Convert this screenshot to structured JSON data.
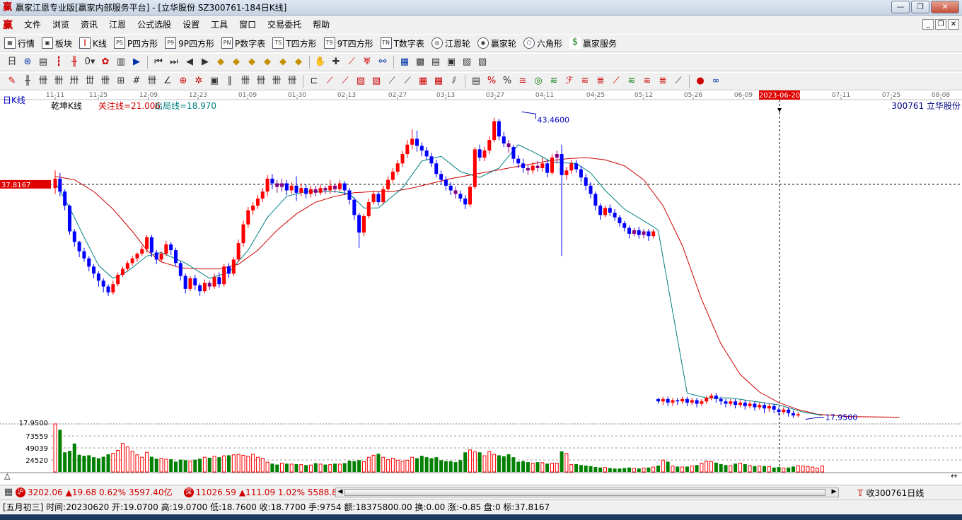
{
  "window": {
    "title": "赢家江恩专业版[赢家内部服务平台] - [立华股份  SZ300761-184日K线]",
    "logo_glyph": "赢"
  },
  "menu": {
    "items": [
      "文件",
      "浏览",
      "资讯",
      "江恩",
      "公式选股",
      "设置",
      "工具",
      "窗口",
      "交易委托",
      "帮助"
    ]
  },
  "toolbar1": {
    "items": [
      {
        "label": "行情",
        "icon": "grid-icon"
      },
      {
        "label": "板块",
        "icon": "blocks-icon"
      },
      {
        "label": "K线",
        "icon": "kline-icon"
      },
      {
        "label": "P四方形",
        "icon": "p-square-icon",
        "tag": "PS"
      },
      {
        "label": "9P四方形",
        "icon": "9p-square-icon",
        "tag": "P9"
      },
      {
        "label": "P数字表",
        "icon": "p-number-table-icon",
        "tag": "PN"
      },
      {
        "label": "T四方形",
        "icon": "t-square-icon",
        "tag": "TS"
      },
      {
        "label": "9T四方形",
        "icon": "9t-square-icon",
        "tag": "T9"
      },
      {
        "label": "T数字表",
        "icon": "t-number-table-icon",
        "tag": "TN"
      },
      {
        "label": "江恩轮",
        "icon": "gann-wheel-icon"
      },
      {
        "label": "赢家轮",
        "icon": "winner-wheel-icon"
      },
      {
        "label": "六角形",
        "icon": "hexagon-icon"
      },
      {
        "label": "赢家服务",
        "icon": "dollar-icon"
      }
    ]
  },
  "chart": {
    "period_label": "日K线",
    "indicator_name": "乾坤K线",
    "focus_line": "关注线=21.006",
    "exit_line": "出局线=18.970",
    "stock_label": "300761  立华股份",
    "cursor_price": "37.8167",
    "cursor_date": "2023-06-20",
    "high_label": "43.4600",
    "low_label": "17.9500",
    "vol_axis": [
      "17.9500",
      "73559",
      "49039",
      "24520"
    ],
    "dates": [
      "11-11",
      "11-25",
      "12-09",
      "12-23",
      "01-09",
      "01-30",
      "02-13",
      "02-27",
      "03-13",
      "03-27",
      "04-11",
      "04-25",
      "05-12",
      "05-26",
      "06-09",
      "2023-06-20",
      "07-11",
      "07-25",
      "08-08"
    ],
    "colors": {
      "up": "#ff0000",
      "down": "#0000ff",
      "neutral": "#800080",
      "vol_up": "#ff0000",
      "vol_down": "#008000",
      "ma_long": "#cc0000",
      "ma_short": "#008080"
    }
  },
  "chart_data": {
    "type": "candlestick",
    "price_range": [
      17.5,
      44.5
    ],
    "candles": [
      [
        37.5,
        38.3,
        39.0,
        37.0
      ],
      [
        38.3,
        37.2,
        38.8,
        36.8
      ],
      [
        37.2,
        36.0,
        37.4,
        35.6
      ],
      [
        36.0,
        33.8,
        36.1,
        33.5
      ],
      [
        33.8,
        32.9,
        34.0,
        32.5
      ],
      [
        32.9,
        32.1,
        33.0,
        31.6
      ],
      [
        32.1,
        31.5,
        32.4,
        31.2
      ],
      [
        31.5,
        30.8,
        31.7,
        30.4
      ],
      [
        30.8,
        30.2,
        31.0,
        29.8
      ],
      [
        30.2,
        29.6,
        30.4,
        29.1
      ],
      [
        29.6,
        29.1,
        29.8,
        28.6
      ],
      [
        29.1,
        28.6,
        29.3,
        28.3
      ],
      [
        28.6,
        29.3,
        29.6,
        28.4
      ],
      [
        29.3,
        30.1,
        30.3,
        29.1
      ],
      [
        30.1,
        30.6,
        30.8,
        29.9
      ],
      [
        30.6,
        31.1,
        31.3,
        30.4
      ],
      [
        31.1,
        31.5,
        31.7,
        30.9
      ],
      [
        31.5,
        31.9,
        32.0,
        31.2
      ],
      [
        31.9,
        32.3,
        32.6,
        31.7
      ],
      [
        32.3,
        33.3,
        33.5,
        32.0
      ],
      [
        33.3,
        32.0,
        33.5,
        31.6
      ],
      [
        32.0,
        31.4,
        32.2,
        31.0
      ],
      [
        31.4,
        31.9,
        32.1,
        31.2
      ],
      [
        31.9,
        32.7,
        33.0,
        31.7
      ],
      [
        32.7,
        32.2,
        32.9,
        31.8
      ],
      [
        32.2,
        31.1,
        32.4,
        30.8
      ],
      [
        31.1,
        30.0,
        31.3,
        29.6
      ],
      [
        30.0,
        28.9,
        30.2,
        28.5
      ],
      [
        28.9,
        29.8,
        30.0,
        28.7
      ],
      [
        29.8,
        29.2,
        30.1,
        28.8
      ],
      [
        29.2,
        28.7,
        29.4,
        28.3
      ],
      [
        28.7,
        29.4,
        29.7,
        28.5
      ],
      [
        29.4,
        29.1,
        29.6,
        28.8
      ],
      [
        29.1,
        29.9,
        30.2,
        28.9
      ],
      [
        29.9,
        29.3,
        30.3,
        29.0
      ],
      [
        29.3,
        30.8,
        31.0,
        29.1
      ],
      [
        30.8,
        30.2,
        31.1,
        29.8
      ],
      [
        30.2,
        31.4,
        31.6,
        30.0
      ],
      [
        31.4,
        32.8,
        33.1,
        31.2
      ],
      [
        32.8,
        34.4,
        34.7,
        32.5
      ],
      [
        34.4,
        35.6,
        35.9,
        34.1
      ],
      [
        35.6,
        36.0,
        36.3,
        35.2
      ],
      [
        36.0,
        36.6,
        36.9,
        35.7
      ],
      [
        36.6,
        37.2,
        37.5,
        36.3
      ],
      [
        37.2,
        38.3,
        38.6,
        36.8
      ],
      [
        38.3,
        37.9,
        38.7,
        37.4
      ],
      [
        37.9,
        37.6,
        38.2,
        37.1
      ],
      [
        37.6,
        37.9,
        38.3,
        37.2
      ],
      [
        37.9,
        37.3,
        38.2,
        36.9
      ],
      [
        37.3,
        37.7,
        38.0,
        37.0
      ],
      [
        37.7,
        37.1,
        38.5,
        36.4
      ],
      [
        37.1,
        37.5,
        37.9,
        36.8
      ],
      [
        37.5,
        37.0,
        37.8,
        36.6
      ],
      [
        37.0,
        37.4,
        37.7,
        36.7
      ],
      [
        37.4,
        37.1,
        37.7,
        36.8
      ],
      [
        37.1,
        37.5,
        37.8,
        36.9
      ],
      [
        37.5,
        37.3,
        37.7,
        37.0
      ],
      [
        37.3,
        37.7,
        38.2,
        37.0
      ],
      [
        37.7,
        37.4,
        37.9,
        37.1
      ],
      [
        37.4,
        37.9,
        38.2,
        37.2
      ],
      [
        37.9,
        37.3,
        38.1,
        36.9
      ],
      [
        37.3,
        36.5,
        37.5,
        36.1
      ],
      [
        36.5,
        35.2,
        36.7,
        34.8
      ],
      [
        35.2,
        33.7,
        35.4,
        32.4
      ],
      [
        33.7,
        35.1,
        35.3,
        33.4
      ],
      [
        35.1,
        36.3,
        36.6,
        34.9
      ],
      [
        36.3,
        37.0,
        37.3,
        36.1
      ],
      [
        37.0,
        36.3,
        37.2,
        36.0
      ],
      [
        36.3,
        37.4,
        37.7,
        36.1
      ],
      [
        37.4,
        38.2,
        38.5,
        37.2
      ],
      [
        38.2,
        38.9,
        39.2,
        37.9
      ],
      [
        38.9,
        39.6,
        39.9,
        38.6
      ],
      [
        39.6,
        40.4,
        40.7,
        39.3
      ],
      [
        40.4,
        41.2,
        41.6,
        40.1
      ],
      [
        41.2,
        41.7,
        42.5,
        40.8
      ],
      [
        41.7,
        41.1,
        42.4,
        40.6
      ],
      [
        41.1,
        40.7,
        41.4,
        40.2
      ],
      [
        40.7,
        40.2,
        41.0,
        39.9
      ],
      [
        40.2,
        39.6,
        40.5,
        39.3
      ],
      [
        39.6,
        38.7,
        39.9,
        38.4
      ],
      [
        38.7,
        38.2,
        39.0,
        37.8
      ],
      [
        38.2,
        37.7,
        38.5,
        37.3
      ],
      [
        37.7,
        37.3,
        38.0,
        36.9
      ],
      [
        37.3,
        37.0,
        37.6,
        36.6
      ],
      [
        37.0,
        36.6,
        37.3,
        36.3
      ],
      [
        36.6,
        36.1,
        36.9,
        35.7
      ],
      [
        36.1,
        37.6,
        37.8,
        35.9
      ],
      [
        37.6,
        40.8,
        41.0,
        37.4
      ],
      [
        40.8,
        40.1,
        41.2,
        39.8
      ],
      [
        40.1,
        40.7,
        41.0,
        39.8
      ],
      [
        40.7,
        41.6,
        41.9,
        40.4
      ],
      [
        41.6,
        43.2,
        43.5,
        41.4
      ],
      [
        43.2,
        41.9,
        43.4,
        41.6
      ],
      [
        41.9,
        41.3,
        42.3,
        41.0
      ],
      [
        41.3,
        41.0,
        41.6,
        40.5
      ],
      [
        41.0,
        40.0,
        41.2,
        39.6
      ],
      [
        40.0,
        39.6,
        40.3,
        39.2
      ],
      [
        39.6,
        39.2,
        40.0,
        38.8
      ],
      [
        39.2,
        39.0,
        39.5,
        38.6
      ],
      [
        39.0,
        39.4,
        39.7,
        38.7
      ],
      [
        39.4,
        39.2,
        39.8,
        38.9
      ],
      [
        39.2,
        39.6,
        40.1,
        38.9
      ],
      [
        39.6,
        38.8,
        39.9,
        38.4
      ],
      [
        38.8,
        40.1,
        40.4,
        38.6
      ],
      [
        40.1,
        40.4,
        40.7,
        39.6
      ],
      [
        40.4,
        38.6,
        41.2,
        31.7
      ],
      [
        38.6,
        39.0,
        39.3,
        38.2
      ],
      [
        39.0,
        39.6,
        39.9,
        38.7
      ],
      [
        39.6,
        39.1,
        39.9,
        38.8
      ],
      [
        39.1,
        38.4,
        39.4,
        38.0
      ],
      [
        38.4,
        37.7,
        38.7,
        37.3
      ],
      [
        37.7,
        37.0,
        38.0,
        36.6
      ],
      [
        37.0,
        36.0,
        37.2,
        35.6
      ],
      [
        36.0,
        35.2,
        36.2,
        34.8
      ],
      [
        35.2,
        35.8,
        36.0,
        35.0
      ],
      [
        35.8,
        35.4,
        36.1,
        35.1
      ],
      [
        35.4,
        35.0,
        35.7,
        34.7
      ],
      [
        35.0,
        34.5,
        35.2,
        34.2
      ],
      [
        34.5,
        34.1,
        34.7,
        33.8
      ],
      [
        34.1,
        33.6,
        34.3,
        33.2
      ],
      [
        33.6,
        33.9,
        34.1,
        33.4
      ],
      [
        33.9,
        33.5,
        34.2,
        33.2
      ],
      [
        33.5,
        33.8,
        34.0,
        33.2
      ],
      [
        33.8,
        33.4,
        34.0,
        33.0
      ],
      [
        33.4,
        33.8,
        34.0,
        33.2
      ],
      [
        19.5,
        19.3,
        19.6,
        19.1
      ],
      [
        19.3,
        19.5,
        19.7,
        19.0
      ],
      [
        19.5,
        19.2,
        19.7,
        18.9
      ],
      [
        19.2,
        19.4,
        19.6,
        18.9
      ],
      [
        19.4,
        19.3,
        19.6,
        19.0
      ],
      [
        19.3,
        19.5,
        19.7,
        19.1
      ],
      [
        19.5,
        19.2,
        19.7,
        18.9
      ],
      [
        19.2,
        19.4,
        19.6,
        19.0
      ],
      [
        19.4,
        19.1,
        19.6,
        18.8
      ],
      [
        19.1,
        19.3,
        19.5,
        18.9
      ],
      [
        19.3,
        19.6,
        19.8,
        19.1
      ],
      [
        19.6,
        19.8,
        20.0,
        19.4
      ],
      [
        19.8,
        19.5,
        20.0,
        19.2
      ],
      [
        19.5,
        19.3,
        19.7,
        19.0
      ],
      [
        19.3,
        19.1,
        19.5,
        18.8
      ],
      [
        19.1,
        19.3,
        19.5,
        18.9
      ],
      [
        19.3,
        19.0,
        19.5,
        18.7
      ],
      [
        19.0,
        19.2,
        19.4,
        18.8
      ],
      [
        19.2,
        18.9,
        19.4,
        18.6
      ],
      [
        18.9,
        19.1,
        19.3,
        18.7
      ],
      [
        19.1,
        18.8,
        19.3,
        18.5
      ],
      [
        18.8,
        19.0,
        19.2,
        18.6
      ],
      [
        19.0,
        18.7,
        19.2,
        18.3
      ],
      [
        18.7,
        18.9,
        19.1,
        18.4
      ],
      [
        18.9,
        18.6,
        19.1,
        18.3
      ],
      [
        18.6,
        18.4,
        18.8,
        18.1
      ],
      [
        18.4,
        18.6,
        18.8,
        18.2
      ],
      [
        18.6,
        18.3,
        18.8,
        18.0
      ],
      [
        18.3,
        18.1,
        18.5,
        17.9
      ],
      [
        18.1,
        18.2,
        18.4,
        17.95
      ]
    ],
    "ma_short": [
      [
        0,
        38.0
      ],
      [
        3,
        35.8
      ],
      [
        6,
        33.3
      ],
      [
        9,
        30.9
      ],
      [
        12,
        29.8
      ],
      [
        15,
        30.4
      ],
      [
        19,
        31.7
      ],
      [
        22,
        32.0
      ],
      [
        27,
        31.1
      ],
      [
        32,
        29.8
      ],
      [
        36,
        30.3
      ],
      [
        40,
        32.2
      ],
      [
        44,
        35.0
      ],
      [
        48,
        36.8
      ],
      [
        52,
        37.2
      ],
      [
        58,
        37.2
      ],
      [
        61,
        37.0
      ],
      [
        64,
        35.8
      ],
      [
        67,
        35.8
      ],
      [
        72,
        37.5
      ],
      [
        76,
        39.8
      ],
      [
        80,
        40.2
      ],
      [
        84,
        38.9
      ],
      [
        88,
        38.4
      ],
      [
        92,
        39.2
      ],
      [
        96,
        41.2
      ],
      [
        99,
        40.6
      ],
      [
        103,
        39.7
      ],
      [
        108,
        39.6
      ],
      [
        111,
        38.8
      ],
      [
        114,
        37.3
      ],
      [
        118,
        35.7
      ],
      [
        124,
        34.2
      ],
      [
        125,
        33.9
      ],
      [
        131,
        20.0
      ],
      [
        135,
        19.6
      ],
      [
        140,
        19.6
      ],
      [
        145,
        19.3
      ],
      [
        150,
        19.0
      ],
      [
        155,
        18.4
      ],
      [
        159,
        18.1
      ]
    ],
    "ma_long": [
      [
        0,
        38.5
      ],
      [
        4,
        38.2
      ],
      [
        8,
        37.2
      ],
      [
        12,
        35.7
      ],
      [
        16,
        33.8
      ],
      [
        19,
        32.2
      ],
      [
        22,
        31.2
      ],
      [
        26,
        30.7
      ],
      [
        30,
        30.6
      ],
      [
        34,
        30.6
      ],
      [
        38,
        31.0
      ],
      [
        42,
        32.2
      ],
      [
        46,
        33.9
      ],
      [
        50,
        35.3
      ],
      [
        54,
        36.3
      ],
      [
        58,
        36.8
      ],
      [
        62,
        37.1
      ],
      [
        66,
        37.2
      ],
      [
        70,
        37.2
      ],
      [
        74,
        37.5
      ],
      [
        78,
        37.9
      ],
      [
        82,
        38.3
      ],
      [
        86,
        38.6
      ],
      [
        90,
        38.9
      ],
      [
        94,
        39.2
      ],
      [
        98,
        39.5
      ],
      [
        102,
        39.8
      ],
      [
        106,
        40.0
      ],
      [
        110,
        40.1
      ],
      [
        114,
        39.9
      ],
      [
        118,
        39.4
      ],
      [
        122,
        38.2
      ],
      [
        126,
        36.0
      ],
      [
        130,
        32.6
      ],
      [
        134,
        28.0
      ],
      [
        138,
        24.2
      ],
      [
        142,
        21.6
      ],
      [
        146,
        20.1
      ],
      [
        150,
        19.2
      ],
      [
        154,
        18.6
      ],
      [
        158,
        18.2
      ],
      [
        165,
        18.0
      ],
      [
        175,
        17.95
      ]
    ],
    "volumes": [
      98000,
      86000,
      40000,
      43000,
      58000,
      35000,
      33000,
      34000,
      30000,
      28000,
      31000,
      36000,
      38000,
      44000,
      58000,
      51000,
      42000,
      35000,
      30000,
      40000,
      31000,
      27000,
      28000,
      26000,
      26000,
      21000,
      25000,
      24000,
      22000,
      25000,
      27000,
      30000,
      29000,
      32000,
      30000,
      33000,
      34000,
      35000,
      36000,
      34000,
      32000,
      36000,
      30000,
      28000,
      20000,
      17000,
      15000,
      18000,
      17000,
      16000,
      16000,
      15000,
      14000,
      14000,
      18000,
      16000,
      15000,
      15000,
      17000,
      16000,
      18000,
      23000,
      22000,
      24000,
      21000,
      30000,
      34000,
      37000,
      30000,
      25000,
      28000,
      24000,
      22000,
      24000,
      30000,
      28000,
      33000,
      30000,
      28000,
      30000,
      24000,
      22000,
      22000,
      20000,
      24000,
      40000,
      45000,
      41000,
      40000,
      33000,
      42000,
      36000,
      34000,
      32000,
      36000,
      30000,
      21000,
      22000,
      20000,
      18000,
      20000,
      19000,
      17000,
      18000,
      18000,
      42000,
      38000,
      15000,
      16000,
      14000,
      13000,
      12000,
      10000,
      9000,
      9000,
      8000,
      7000,
      7000,
      8000,
      9000,
      7000,
      7000,
      8000,
      9000,
      10000,
      13000,
      24000,
      21000,
      12000,
      11000,
      10000,
      11000,
      12000,
      14000,
      18000,
      22000,
      21000,
      19000,
      16000,
      14000,
      13000,
      17000,
      18000,
      16000,
      13000,
      12000,
      12000,
      12000,
      11000,
      9000,
      10000,
      8000,
      9000,
      11000,
      13000,
      12000,
      11000,
      10000,
      8000,
      12000
    ],
    "volume_range": [
      0,
      98000
    ]
  },
  "status1": {
    "sh_badge": "沪",
    "sh_index": "3202.06",
    "sh_change": "▲19.68 0.62% 3597.40亿",
    "sz_badge": "深",
    "sz_index": "11026.59",
    "sz_change": "▲111.09 1.02% 5588.82",
    "right_text": "收300761日线"
  },
  "status2": {
    "text": "[五月初三] 时间:20230620 开:19.0700 高:19.0700 低:18.7600 收:18.7700 手:9754 额:18375800.00 换:0.00 涨:-0.85 盘:0 标:37.8167"
  }
}
